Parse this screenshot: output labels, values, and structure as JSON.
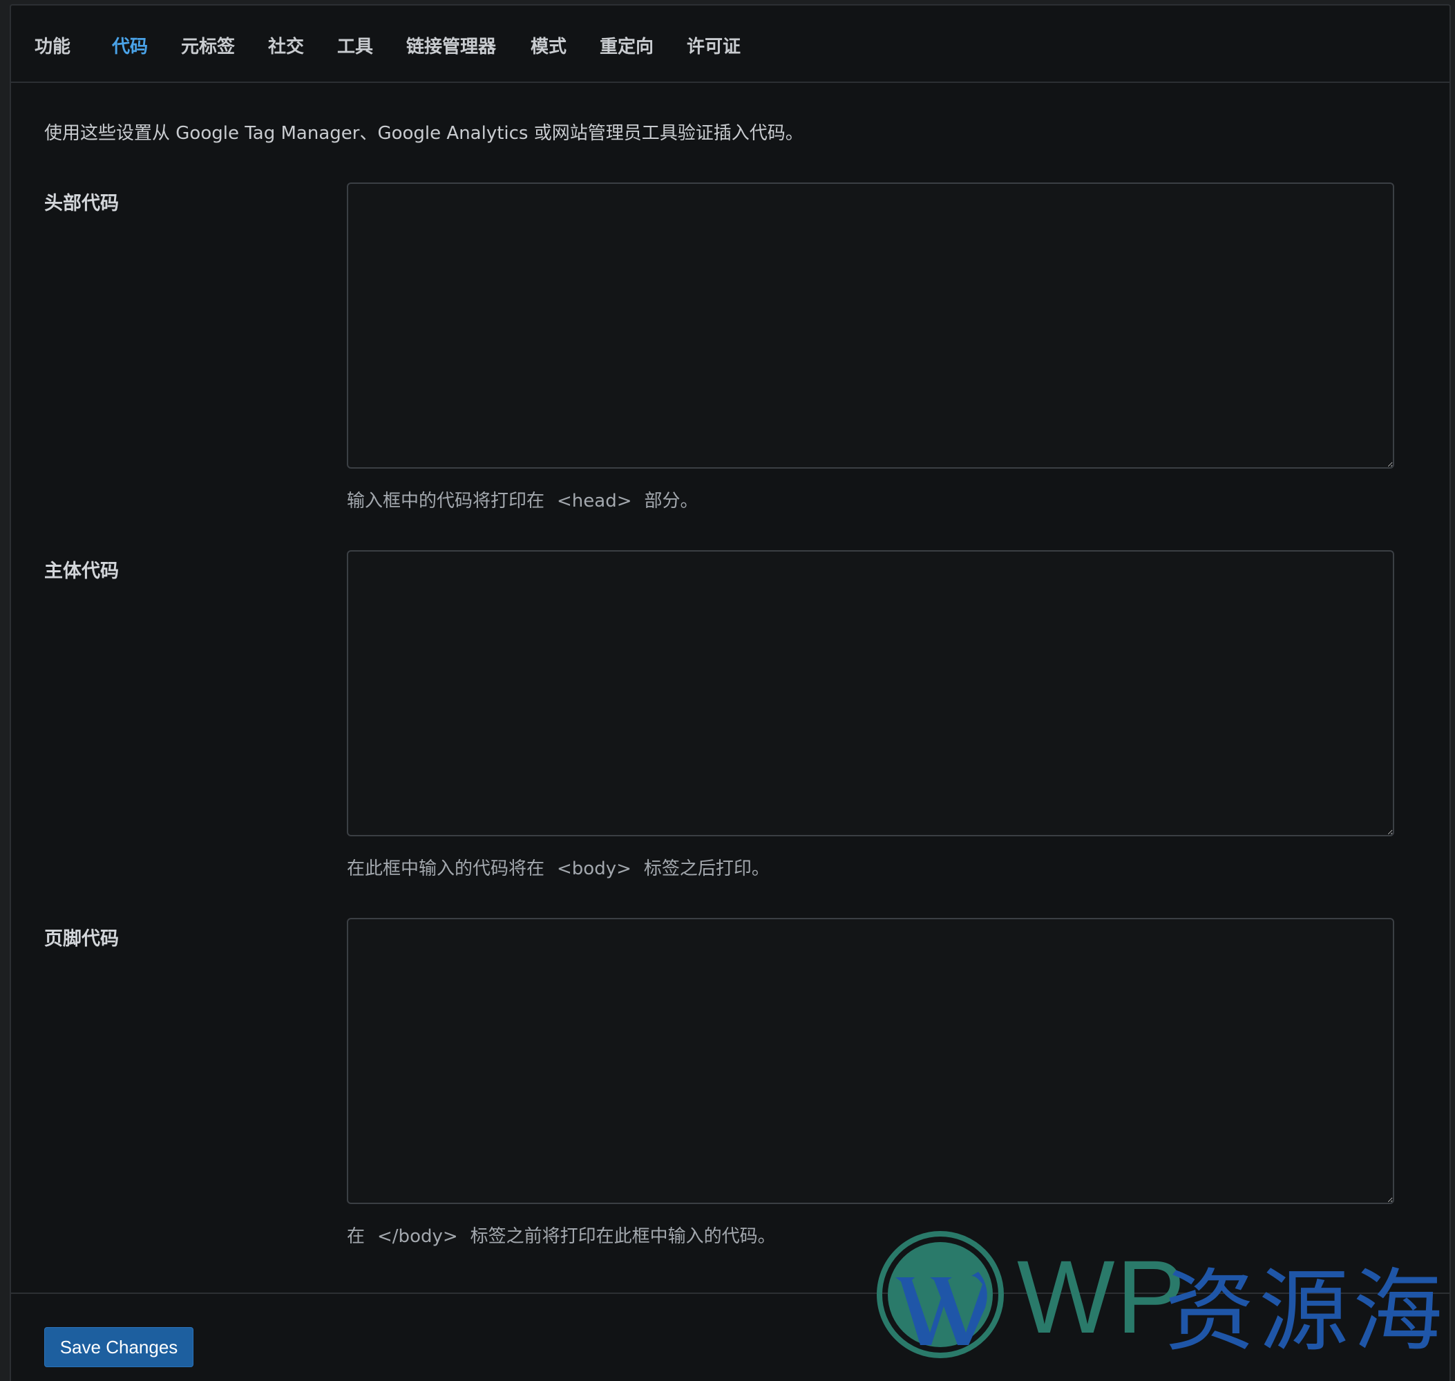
{
  "tabs": [
    {
      "label": "功能",
      "active": false
    },
    {
      "label": "代码",
      "active": true
    },
    {
      "label": "元标签",
      "active": false
    },
    {
      "label": "社交",
      "active": false
    },
    {
      "label": "工具",
      "active": false
    },
    {
      "label": "链接管理器",
      "active": false
    },
    {
      "label": "模式",
      "active": false
    },
    {
      "label": "重定向",
      "active": false
    },
    {
      "label": "许可证",
      "active": false
    }
  ],
  "intro": "使用这些设置从 Google Tag Manager、Google Analytics 或网站管理员工具验证插入代码。",
  "fields": {
    "head": {
      "label": "头部代码",
      "value": "",
      "hint_before": "输入框中的代码将打印在",
      "hint_code": "<head>",
      "hint_after": "部分。"
    },
    "body": {
      "label": "主体代码",
      "value": "",
      "hint_before": "在此框中输入的代码将在",
      "hint_code": "<body>",
      "hint_after": "标签之后打印。"
    },
    "footer": {
      "label": "页脚代码",
      "value": "",
      "hint_before": "在",
      "hint_code": "</body>",
      "hint_after": "标签之前将打印在此框中输入的代码。"
    }
  },
  "save_button": "Save Changes",
  "watermark": {
    "wp": "WP",
    "cn": "资源海"
  },
  "colors": {
    "active_tab": "#4aa3e8",
    "button": "#1d5f9f",
    "watermark_green": "#2a7a6a",
    "watermark_blue": "#1f56a8"
  }
}
